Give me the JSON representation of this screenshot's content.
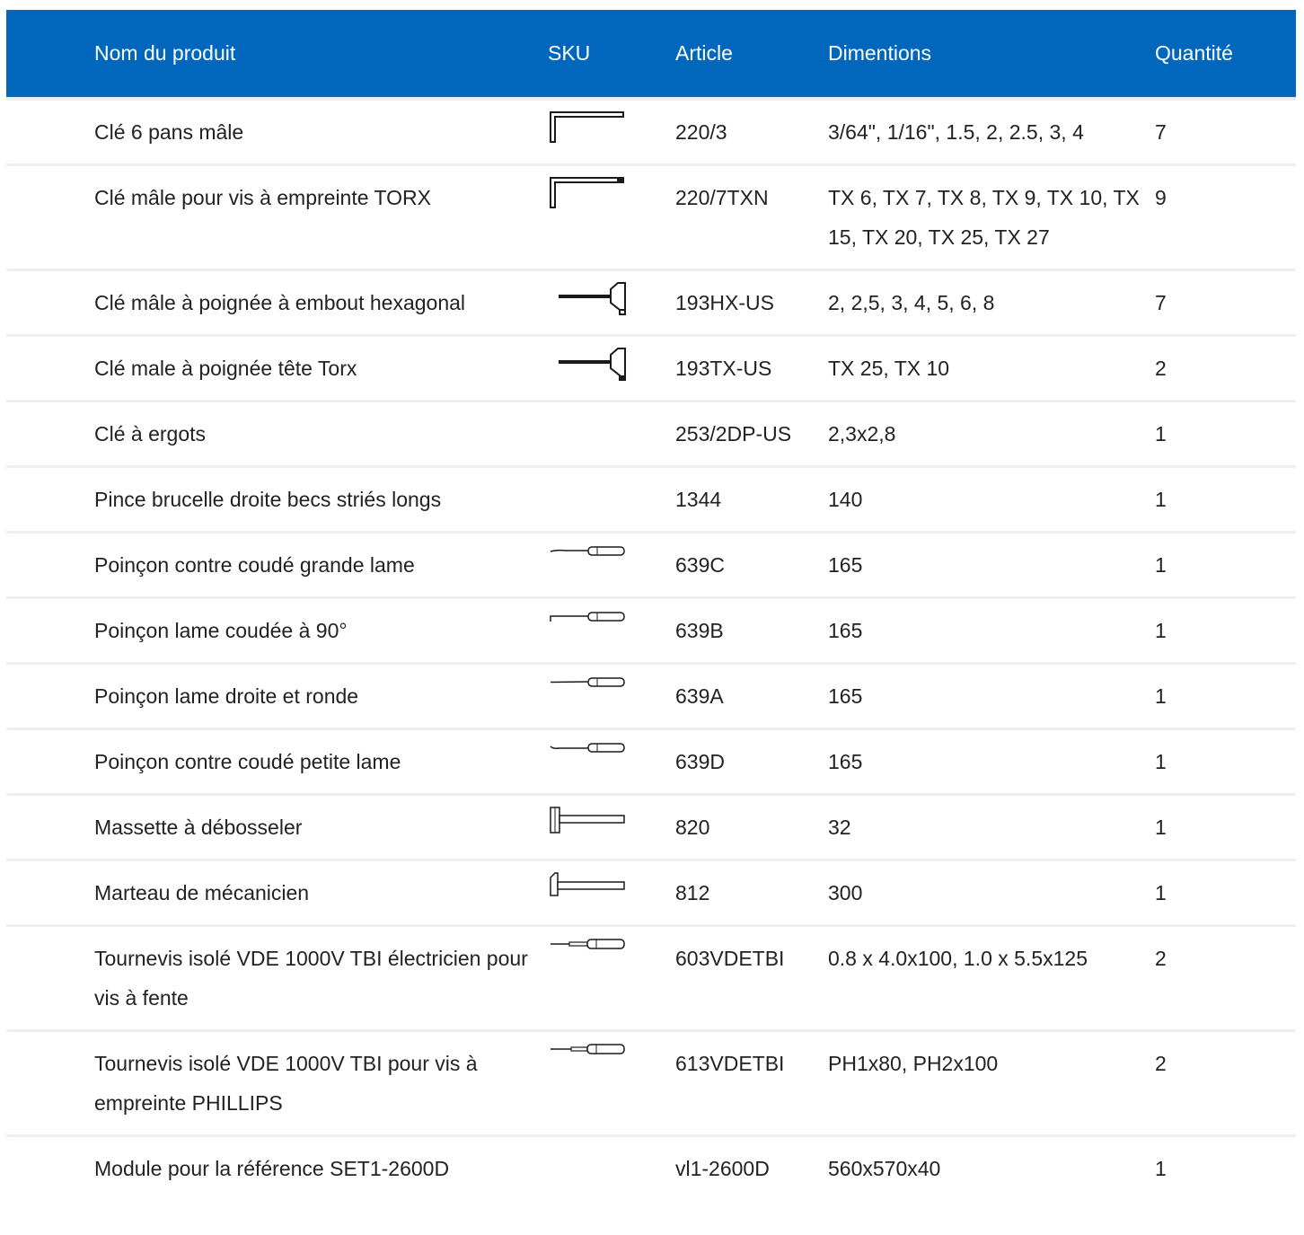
{
  "table": {
    "headers": {
      "name": "Nom du produit",
      "sku": "SKU",
      "article": "Article",
      "dimensions": "Dimentions",
      "quantity": "Quantité"
    },
    "rows": [
      {
        "name": "Clé 6 pans mâle",
        "icon": "hex-key-icon",
        "article": "220/3",
        "dimensions": "3/64\", 1/16\", 1.5, 2, 2.5, 3, 4",
        "quantity": "7"
      },
      {
        "name": "Clé mâle pour vis à empreinte TORX",
        "icon": "torx-key-icon",
        "article": "220/7TXN",
        "dimensions": "TX 6, TX 7, TX 8, TX 9, TX 10, TX 15, TX 20, TX 25, TX 27",
        "quantity": "9"
      },
      {
        "name": "Clé mâle à poignée à embout hexagonal",
        "icon": "t-handle-hex-key-icon",
        "article": "193HX-US",
        "dimensions": "2, 2,5, 3, 4, 5, 6, 8",
        "quantity": "7"
      },
      {
        "name": "Clé male à poignée tête Torx",
        "icon": "t-handle-torx-key-icon",
        "article": "193TX-US",
        "dimensions": "TX 25, TX 10",
        "quantity": "2"
      },
      {
        "name": "Clé à ergots",
        "icon": "",
        "article": "253/2DP-US",
        "dimensions": "2,3x2,8",
        "quantity": "1"
      },
      {
        "name": "Pince brucelle droite becs striés longs",
        "icon": "",
        "article": "1344",
        "dimensions": "140",
        "quantity": "1"
      },
      {
        "name": "Poinçon contre coudé grande lame",
        "icon": "offset-awl-icon",
        "article": "639C",
        "dimensions": "165",
        "quantity": "1"
      },
      {
        "name": "Poinçon lame coudée à 90°",
        "icon": "bent-awl-icon",
        "article": "639B",
        "dimensions": "165",
        "quantity": "1"
      },
      {
        "name": "Poinçon lame droite et ronde",
        "icon": "straight-awl-icon",
        "article": "639A",
        "dimensions": "165",
        "quantity": "1"
      },
      {
        "name": "Poinçon contre coudé petite lame",
        "icon": "small-offset-awl-icon",
        "article": "639D",
        "dimensions": "165",
        "quantity": "1"
      },
      {
        "name": "Massette à débosseler",
        "icon": "mallet-icon",
        "article": "820",
        "dimensions": "32",
        "quantity": "1"
      },
      {
        "name": "Marteau de mécanicien",
        "icon": "hammer-icon",
        "article": "812",
        "dimensions": "300",
        "quantity": "1"
      },
      {
        "name": "Tournevis isolé VDE 1000V TBI électricien pour vis à fente",
        "icon": "insulated-screwdriver-icon",
        "article": "603VDETBI",
        "dimensions": "0.8 x 4.0x100, 1.0 x 5.5x125",
        "quantity": "2"
      },
      {
        "name": "Tournevis isolé VDE 1000V TBI pour vis à empreinte PHILLIPS",
        "icon": "insulated-phillips-screwdriver-icon",
        "article": "613VDETBI",
        "dimensions": "PH1x80, PH2x100",
        "quantity": "2"
      },
      {
        "name": "Module pour la référence SET1-2600D",
        "icon": "",
        "article": "vl1-2600D",
        "dimensions": "560x570x40",
        "quantity": "1"
      }
    ]
  },
  "colors": {
    "header_background": "#0067bd",
    "header_text": "#ffffff",
    "row_divider": "#eceff2",
    "body_text": "#222222",
    "icon_stroke": "#1a1a1a"
  }
}
